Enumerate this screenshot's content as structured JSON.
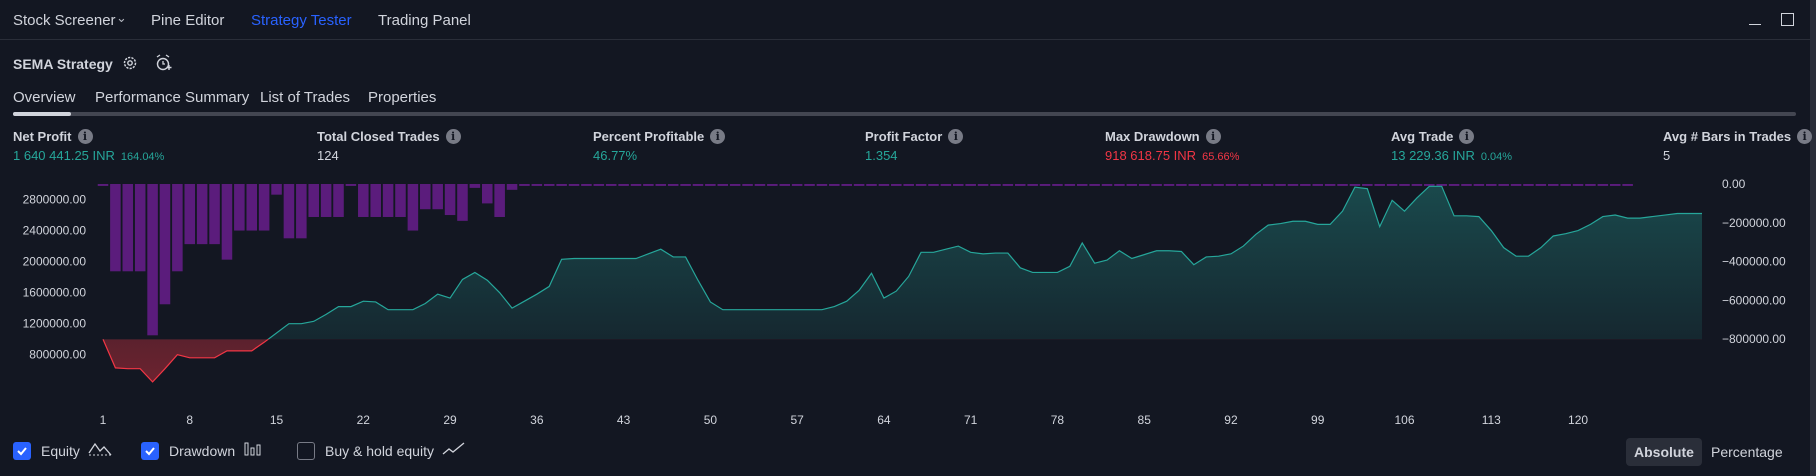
{
  "topbar": {
    "tabs": [
      {
        "label": "Stock Screener"
      },
      {
        "label": "Pine Editor"
      },
      {
        "label": "Strategy Tester"
      },
      {
        "label": "Trading Panel"
      }
    ]
  },
  "strategy": {
    "title": "SEMA Strategy"
  },
  "subtabs": [
    {
      "label": "Overview"
    },
    {
      "label": "Performance Summary"
    },
    {
      "label": "List of Trades"
    },
    {
      "label": "Properties"
    }
  ],
  "metrics": [
    {
      "label": "Net Profit",
      "value": "1 640 441.25 INR",
      "pct": "164.04%",
      "tone": "green"
    },
    {
      "label": "Total Closed Trades",
      "value": "124",
      "pct": "",
      "tone": "white"
    },
    {
      "label": "Percent Profitable",
      "value": "46.77%",
      "pct": "",
      "tone": "green"
    },
    {
      "label": "Profit Factor",
      "value": "1.354",
      "pct": "",
      "tone": "green"
    },
    {
      "label": "Max Drawdown",
      "value": "918 618.75 INR",
      "pct": "65.66%",
      "tone": "red"
    },
    {
      "label": "Avg Trade",
      "value": "13 229.36 INR",
      "pct": "0.04%",
      "tone": "green"
    },
    {
      "label": "Avg # Bars in Trades",
      "value": "5",
      "pct": "",
      "tone": "white"
    }
  ],
  "chart_data": {
    "type": "area",
    "x_ticks": [
      "1",
      "8",
      "15",
      "22",
      "29",
      "36",
      "43",
      "50",
      "57",
      "64",
      "71",
      "78",
      "85",
      "92",
      "99",
      "106",
      "113",
      "120"
    ],
    "y_left_ticks": [
      "2800000.00",
      "2400000.00",
      "2000000.00",
      "1600000.00",
      "1200000.00",
      "800000.00"
    ],
    "y_right_ticks": [
      "0.00",
      "−200000.00",
      "−400000.00",
      "−600000.00",
      "−800000.00"
    ],
    "y_left_range": [
      500000,
      3000000
    ],
    "y_right_range": [
      -1000000,
      0
    ],
    "initial_capital": 1000000,
    "equity_color_up": "#26a69a",
    "equity_color_down": "#f23645",
    "drawdown_color": "#7b1fa2",
    "series": [
      {
        "name": "Equity",
        "values": [
          1000000,
          630000,
          620000,
          620000,
          450000,
          620000,
          800000,
          760000,
          760000,
          760000,
          850000,
          850000,
          850000,
          960000,
          1080000,
          1200000,
          1200000,
          1230000,
          1320000,
          1420000,
          1420000,
          1490000,
          1480000,
          1380000,
          1380000,
          1380000,
          1460000,
          1580000,
          1530000,
          1770000,
          1860000,
          1760000,
          1600000,
          1400000,
          1490000,
          1580000,
          1680000,
          2030000,
          2040000,
          2040000,
          2040000,
          2040000,
          2040000,
          2040000,
          2100000,
          2160000,
          2060000,
          2060000,
          1760000,
          1480000,
          1380000,
          1380000,
          1380000,
          1380000,
          1380000,
          1380000,
          1380000,
          1380000,
          1380000,
          1420000,
          1490000,
          1630000,
          1850000,
          1530000,
          1620000,
          1810000,
          2120000,
          2120000,
          2160000,
          2200000,
          2120000,
          2100000,
          2110000,
          2110000,
          1920000,
          1860000,
          1860000,
          1860000,
          1940000,
          2240000,
          1980000,
          2020000,
          2140000,
          2040000,
          2090000,
          2140000,
          2140000,
          2130000,
          1960000,
          2060000,
          2070000,
          2100000,
          2200000,
          2350000,
          2470000,
          2490000,
          2520000,
          2520000,
          2480000,
          2480000,
          2650000,
          2960000,
          2940000,
          2450000,
          2790000,
          2650000,
          2820000,
          2970000,
          2970000,
          2590000,
          2590000,
          2580000,
          2400000,
          2180000,
          2070000,
          2070000,
          2180000,
          2330000,
          2360000,
          2400000,
          2480000,
          2580000,
          2600000,
          2560000,
          2560000,
          2580000,
          2600000,
          2620000,
          2620000,
          2620000
        ]
      },
      {
        "name": "Drawdown",
        "values": [
          -10000,
          -450000,
          -450000,
          -450000,
          -780000,
          -620000,
          -450000,
          -310000,
          -310000,
          -310000,
          -390000,
          -240000,
          -240000,
          -240000,
          -55000,
          -280000,
          -280000,
          -170000,
          -170000,
          -170000,
          -10000,
          -170000,
          -170000,
          -170000,
          -170000,
          -240000,
          -130000,
          -130000,
          -160000,
          -190000,
          -20000,
          -100000,
          -170000,
          -30000,
          -10000,
          -10000,
          -10000,
          -10000,
          -10000,
          -10000,
          -10000,
          -10000,
          -10000,
          -10000,
          -10000,
          -10000,
          -10000,
          -10000,
          -10000,
          -10000,
          -10000,
          -10000,
          -10000,
          -10000,
          -10000,
          -10000,
          -10000,
          -10000,
          -10000,
          -10000,
          -10000,
          -10000,
          -10000,
          -10000,
          -10000,
          -10000,
          -10000,
          -10000,
          -10000,
          -10000,
          -10000,
          -10000,
          -10000,
          -10000,
          -10000,
          -10000,
          -10000,
          -10000,
          -10000,
          -10000,
          -10000,
          -10000,
          -10000,
          -10000,
          -10000,
          -10000,
          -10000,
          -10000,
          -10000,
          -10000,
          -10000,
          -10000,
          -10000,
          -10000,
          -10000,
          -10000,
          -10000,
          -10000,
          -10000,
          -10000,
          -10000,
          -10000,
          -10000,
          -10000,
          -10000,
          -10000,
          -10000,
          -10000,
          -10000,
          -10000,
          -10000,
          -10000,
          -10000,
          -10000,
          -10000,
          -10000,
          -10000,
          -10000,
          -10000,
          -10000,
          -10000,
          -10000,
          -10000,
          -10000
        ]
      },
      {
        "name": "Buy & hold equity",
        "values": []
      }
    ]
  },
  "legend": {
    "equity_label": "Equity",
    "drawdown_label": "Drawdown",
    "buyhold_label": "Buy & hold equity"
  },
  "modes": {
    "absolute": "Absolute",
    "percentage": "Percentage"
  }
}
